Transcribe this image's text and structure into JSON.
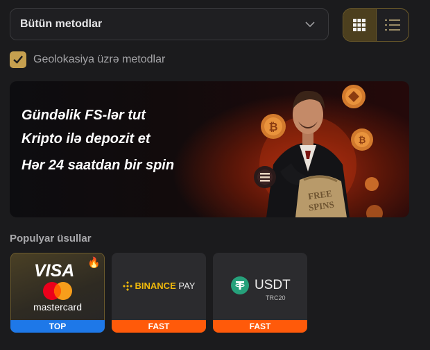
{
  "filters": {
    "method_select": {
      "selected": "Bütün metodlar"
    },
    "view_toggle": {
      "grid_icon": "grid-icon",
      "list_icon": "list-icon",
      "active": "grid"
    },
    "geo_checkbox": {
      "label": "Geolokasiya üzrə metodlar",
      "checked": true
    }
  },
  "banner": {
    "lines": [
      "Gündəlik FS-lər tut",
      "Kripto ilə depozit et",
      "Hər 24 saatdan bir spin"
    ],
    "bag_text_1": "FREE",
    "bag_text_2": "SPINS"
  },
  "popular": {
    "title": "Populyar üsullar",
    "cards": [
      {
        "brand_top": "VISA",
        "brand_bottom": "mastercard",
        "badge": "TOP",
        "icon": "fire-icon"
      },
      {
        "brand": "BINANCE",
        "brand_suffix": "PAY",
        "badge": "FAST",
        "icon": "binance-icon"
      },
      {
        "brand": "USDT",
        "sub": "TRC20",
        "badge": "FAST",
        "icon": "tether-icon"
      }
    ]
  },
  "colors": {
    "accent_gold": "#c6a04f",
    "badge_top": "#1e78e8",
    "badge_fast": "#ff5a0a",
    "tether_green": "#26a17b",
    "binance_yellow": "#f0b90b"
  }
}
